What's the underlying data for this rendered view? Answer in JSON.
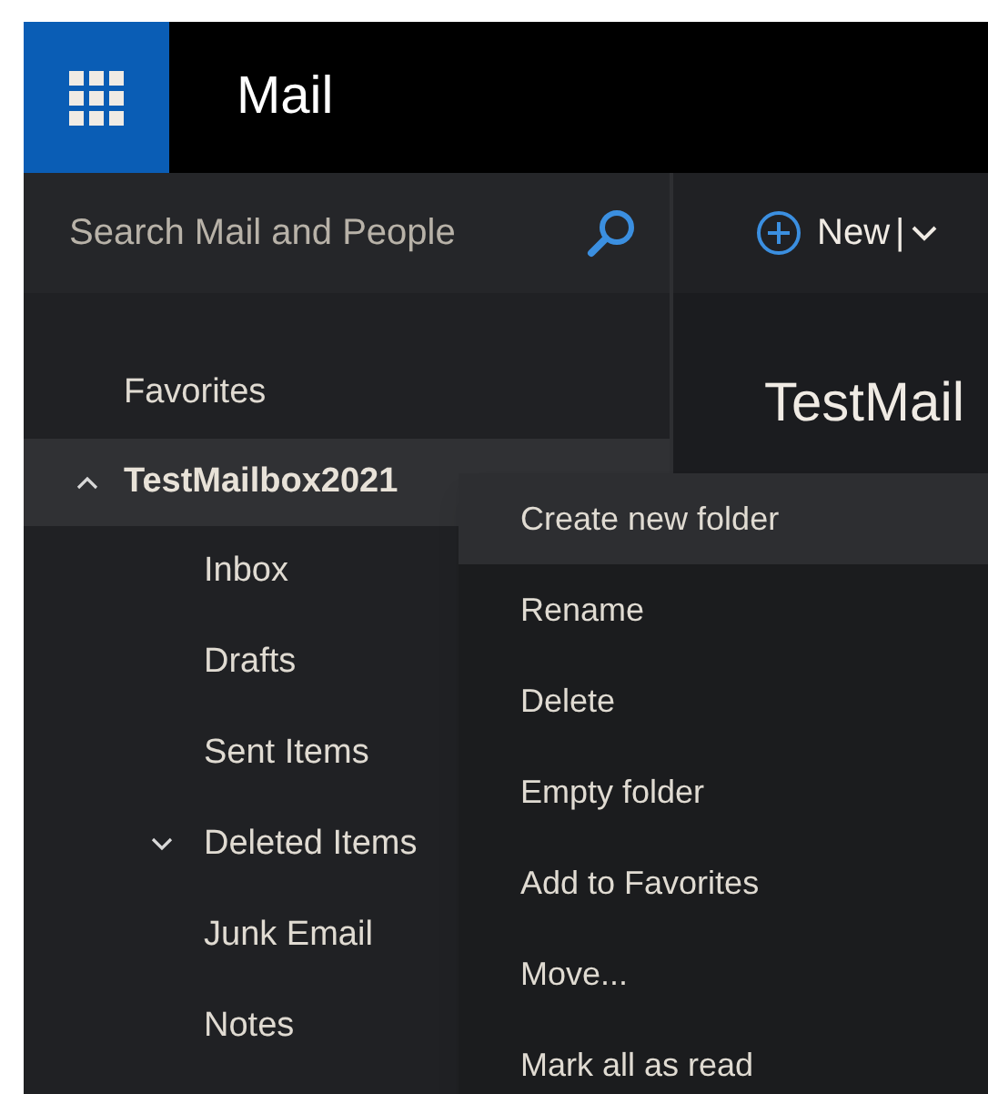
{
  "header": {
    "title": "Mail"
  },
  "search": {
    "placeholder": "Search Mail and People"
  },
  "toolbar": {
    "new_label": "New",
    "separator": "|"
  },
  "heading": "TestMail",
  "sidebar": {
    "favorites": "Favorites",
    "mailbox": {
      "label": "TestMailbox2021",
      "expanded": true,
      "selected": true,
      "children": [
        {
          "label": "Inbox"
        },
        {
          "label": "Drafts"
        },
        {
          "label": "Sent Items"
        },
        {
          "label": "Deleted Items",
          "expanded": false
        },
        {
          "label": "Junk Email"
        },
        {
          "label": "Notes"
        }
      ]
    }
  },
  "context_menu": [
    {
      "label": "Create new folder",
      "selected": true
    },
    {
      "label": "Rename",
      "selected": false
    },
    {
      "label": "Delete",
      "selected": false
    },
    {
      "label": "Empty folder",
      "selected": false
    },
    {
      "label": "Add to Favorites",
      "selected": false
    },
    {
      "label": "Move...",
      "selected": false
    },
    {
      "label": "Mark all as read",
      "selected": false
    }
  ]
}
